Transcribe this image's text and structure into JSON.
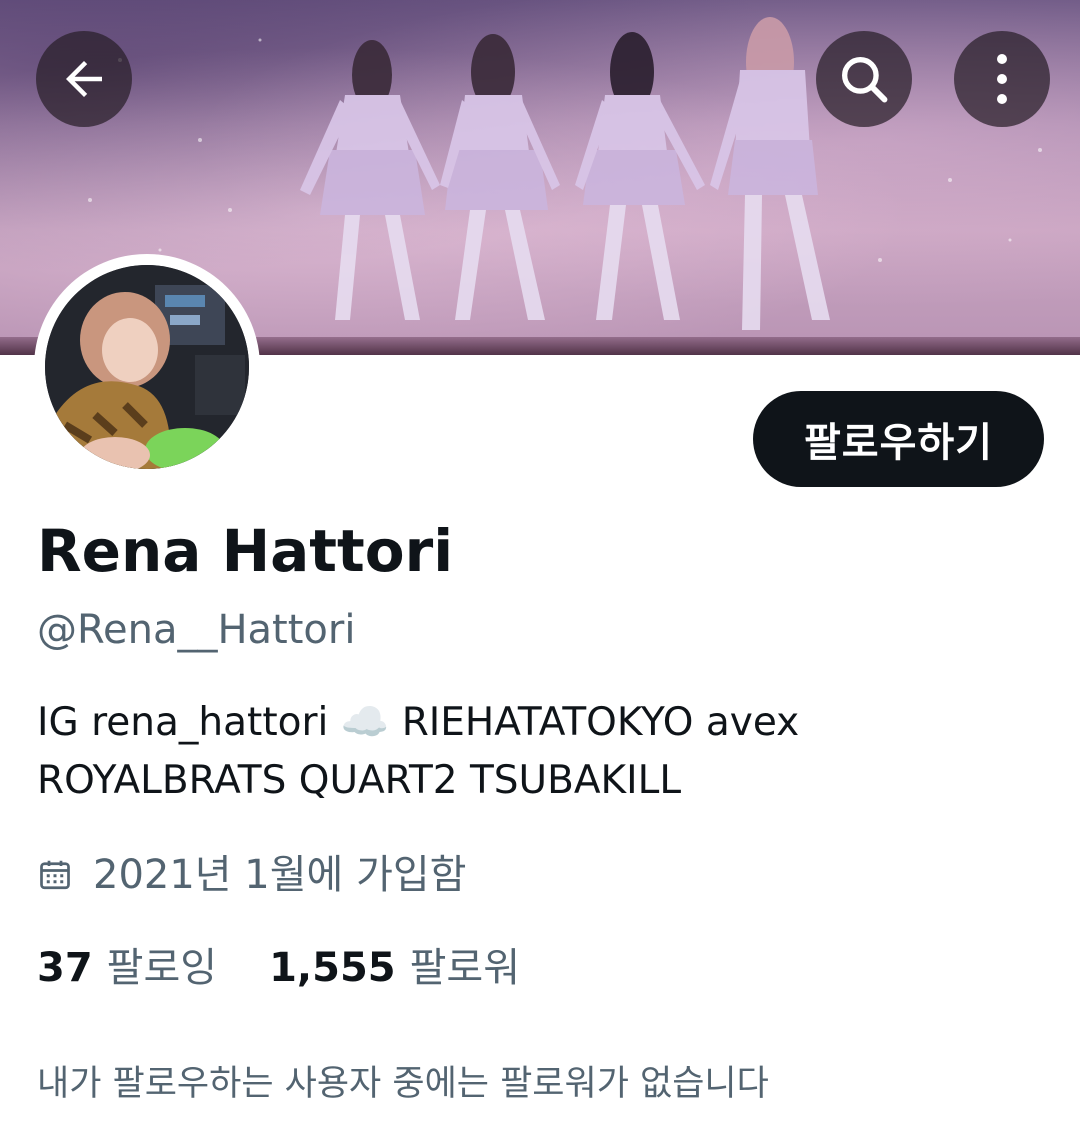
{
  "header": {
    "back_icon": "arrow-left-icon",
    "search_icon": "search-icon",
    "more_icon": "more-vertical-icon",
    "button_bg": "#2a1e28"
  },
  "banner": {
    "description_colors": [
      "#6f5a86",
      "#c7a3c0"
    ]
  },
  "profile": {
    "follow_label": "팔로우하기",
    "name": "Rena Hattori",
    "handle": "@Rena__Hattori",
    "bio_line1": "IG rena_hattori ☁️ RIEHATATOKYO avex",
    "bio_line2": "ROYALBRATS QUART2 TSUBAKILL",
    "joined_icon": "calendar-icon",
    "joined": "2021년 1월에 가입함",
    "following_count": "37",
    "following_label": "팔로잉",
    "followers_count": "1,555",
    "followers_label": "팔로워",
    "mutual_note": "내가 팔로우하는 사용자 중에는 팔로워가 없습니다"
  },
  "colors": {
    "text_primary": "#0f1419",
    "text_secondary": "#536471",
    "follow_button": "#0f1419"
  }
}
